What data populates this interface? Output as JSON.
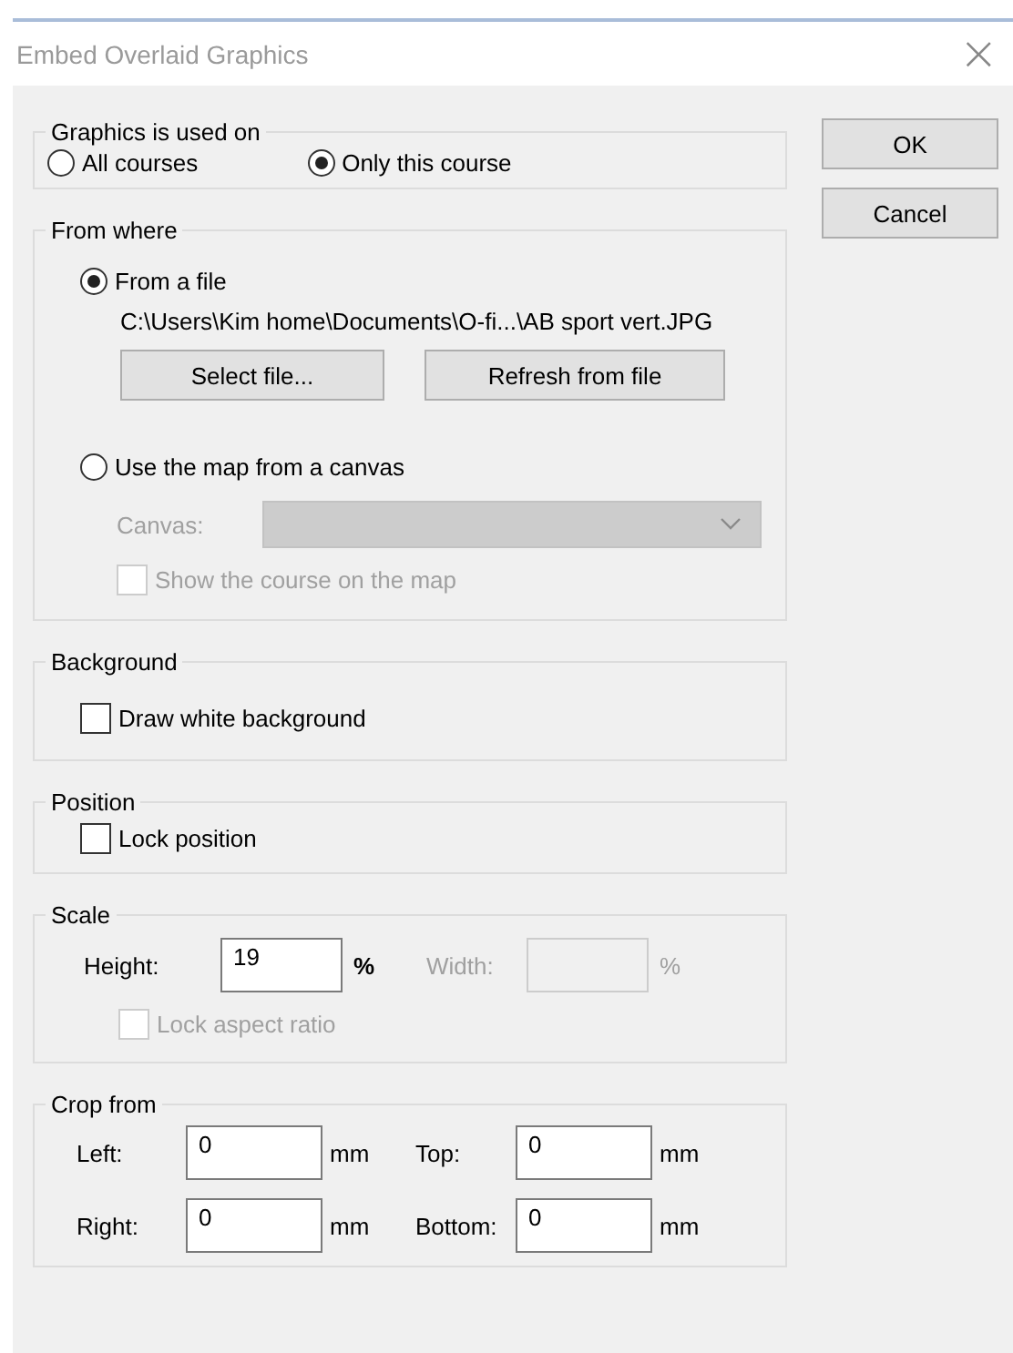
{
  "window": {
    "title": "Embed Overlaid Graphics",
    "close": "×"
  },
  "used_on": {
    "title": "Graphics is used on",
    "options": [
      {
        "label": "All courses",
        "selected": false
      },
      {
        "label": "Only this course",
        "selected": true
      }
    ]
  },
  "from_where": {
    "title": "From where",
    "file_option": {
      "label": "From a file",
      "selected": true
    },
    "file_path": "C:\\Users\\Kim home\\Documents\\O-fi...\\AB sport vert.JPG",
    "select_button": "Select file...",
    "refresh_button": "Refresh from file",
    "canvas_option": {
      "label": "Use the map from a canvas",
      "selected": false
    },
    "canvas_field": {
      "label": "Canvas:",
      "disabled": true
    },
    "show_course": {
      "label": "Show the course on the map",
      "checked": false,
      "disabled": true
    }
  },
  "background": {
    "title": "Background",
    "checkbox": {
      "label": "Draw white background",
      "checked": false,
      "disabled": false
    }
  },
  "position": {
    "title": "Position",
    "checkbox": {
      "label": "Lock position",
      "checked": false,
      "disabled": false
    }
  },
  "scale": {
    "title": "Scale",
    "height": {
      "label": "Height:",
      "value": "19",
      "unit": "%",
      "disabled": false
    },
    "width": {
      "label": "Width:",
      "unit": "%",
      "disabled": true
    },
    "lock_aspect": {
      "label": "Lock aspect ratio",
      "checked": false,
      "disabled": true
    }
  },
  "crop": {
    "title": "Crop from",
    "fields": [
      {
        "label": "Left:",
        "value": "0",
        "unit": "mm"
      },
      {
        "label": "Top:",
        "value": "0",
        "unit": "mm"
      },
      {
        "label": "Right:",
        "value": "0",
        "unit": "mm"
      },
      {
        "label": "Bottom:",
        "value": "0",
        "unit": "mm"
      }
    ]
  },
  "buttons": [
    "OK",
    "Cancel"
  ]
}
